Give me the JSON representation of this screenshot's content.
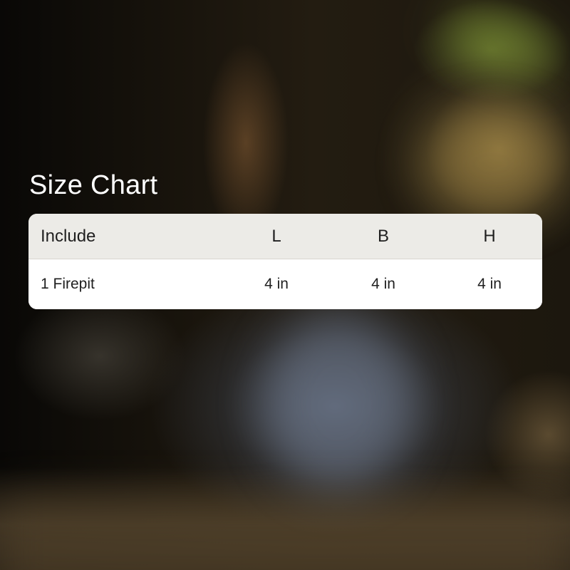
{
  "title": "Size Chart",
  "table": {
    "headers": [
      "Include",
      "L",
      "B",
      "H"
    ],
    "rows": [
      [
        "1 Firepit",
        "4 in",
        "4 in",
        "4 in"
      ]
    ]
  },
  "colors": {
    "title_text": "#ffffff",
    "header_bg": "#ecebe7",
    "body_bg": "#ffffff",
    "cell_text": "#1f1f1f"
  }
}
